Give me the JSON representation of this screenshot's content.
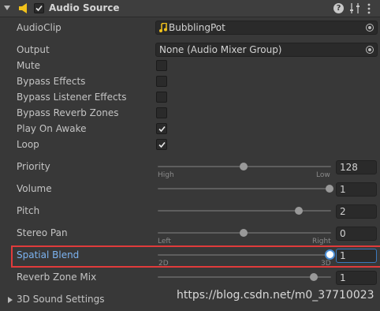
{
  "header": {
    "title": "Audio Source",
    "help_glyph": "?"
  },
  "fields": {
    "audio_clip": {
      "label": "AudioClip",
      "value": "BubblingPot"
    },
    "output": {
      "label": "Output",
      "value": "None (Audio Mixer Group)"
    },
    "mute": {
      "label": "Mute",
      "checked": false
    },
    "bypass_effects": {
      "label": "Bypass Effects",
      "checked": false
    },
    "bypass_listener_effects": {
      "label": "Bypass Listener Effects",
      "checked": false
    },
    "bypass_reverb_zones": {
      "label": "Bypass Reverb Zones",
      "checked": false
    },
    "play_on_awake": {
      "label": "Play On Awake",
      "checked": true
    },
    "loop": {
      "label": "Loop",
      "checked": true
    }
  },
  "sliders": {
    "priority": {
      "label": "Priority",
      "value": "128",
      "fraction": 0.5,
      "min_label": "High",
      "max_label": "Low"
    },
    "volume": {
      "label": "Volume",
      "value": "1",
      "fraction": 1.0
    },
    "pitch": {
      "label": "Pitch",
      "value": "2",
      "fraction": 0.82
    },
    "stereo_pan": {
      "label": "Stereo Pan",
      "value": "0",
      "fraction": 0.5,
      "min_label": "Left",
      "max_label": "Right"
    },
    "spatial_blend": {
      "label": "Spatial Blend",
      "value": "1",
      "fraction": 1.0,
      "min_label": "2D",
      "max_label": "3D"
    },
    "reverb_zone_mix": {
      "label": "Reverb Zone Mix",
      "value": "1",
      "fraction": 0.91
    }
  },
  "foldout": {
    "label": "3D Sound Settings"
  },
  "watermark": "https://blog.csdn.net/m0_37710023",
  "colors": {
    "background": "#383838",
    "active_label": "#7cb3f1",
    "highlight_box": "#e03b3b",
    "speaker_icon": "#f2c21b"
  }
}
